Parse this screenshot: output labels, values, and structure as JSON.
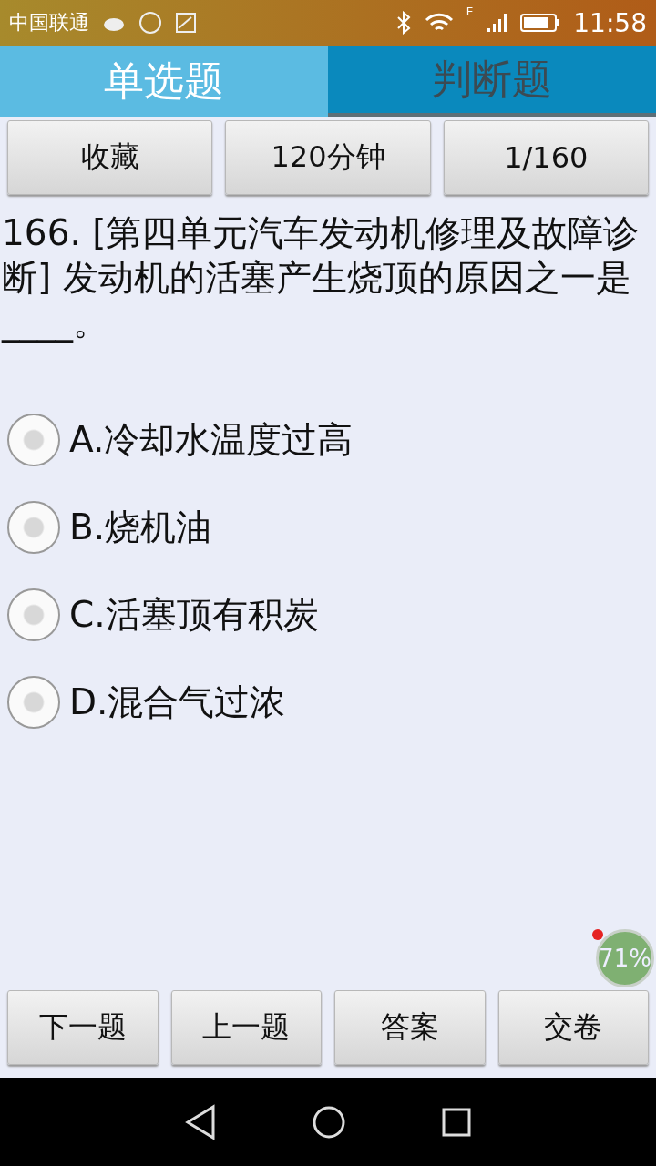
{
  "status_bar": {
    "carrier": "中国联通",
    "time": "11:58",
    "network": "E"
  },
  "tabs": [
    {
      "label": "单选题",
      "selected": true
    },
    {
      "label": "判断题",
      "selected": false
    }
  ],
  "toolbar": [
    "收藏",
    "120分钟",
    "1/160"
  ],
  "question": "166. [第四单元汽车发动机修理及故障诊断] 发动机的活塞产生烧顶的原因之一是____。",
  "options": [
    {
      "label": "A.冷却水温度过高",
      "selected": false
    },
    {
      "label": "B.烧机油",
      "selected": false
    },
    {
      "label": "C.活塞顶有积炭",
      "selected": false
    },
    {
      "label": "D.混合气过浓",
      "selected": false
    }
  ],
  "bottom_buttons": [
    "下一题",
    "上一题",
    "答案",
    "交卷"
  ],
  "floating_badge": {
    "text": "71%"
  }
}
